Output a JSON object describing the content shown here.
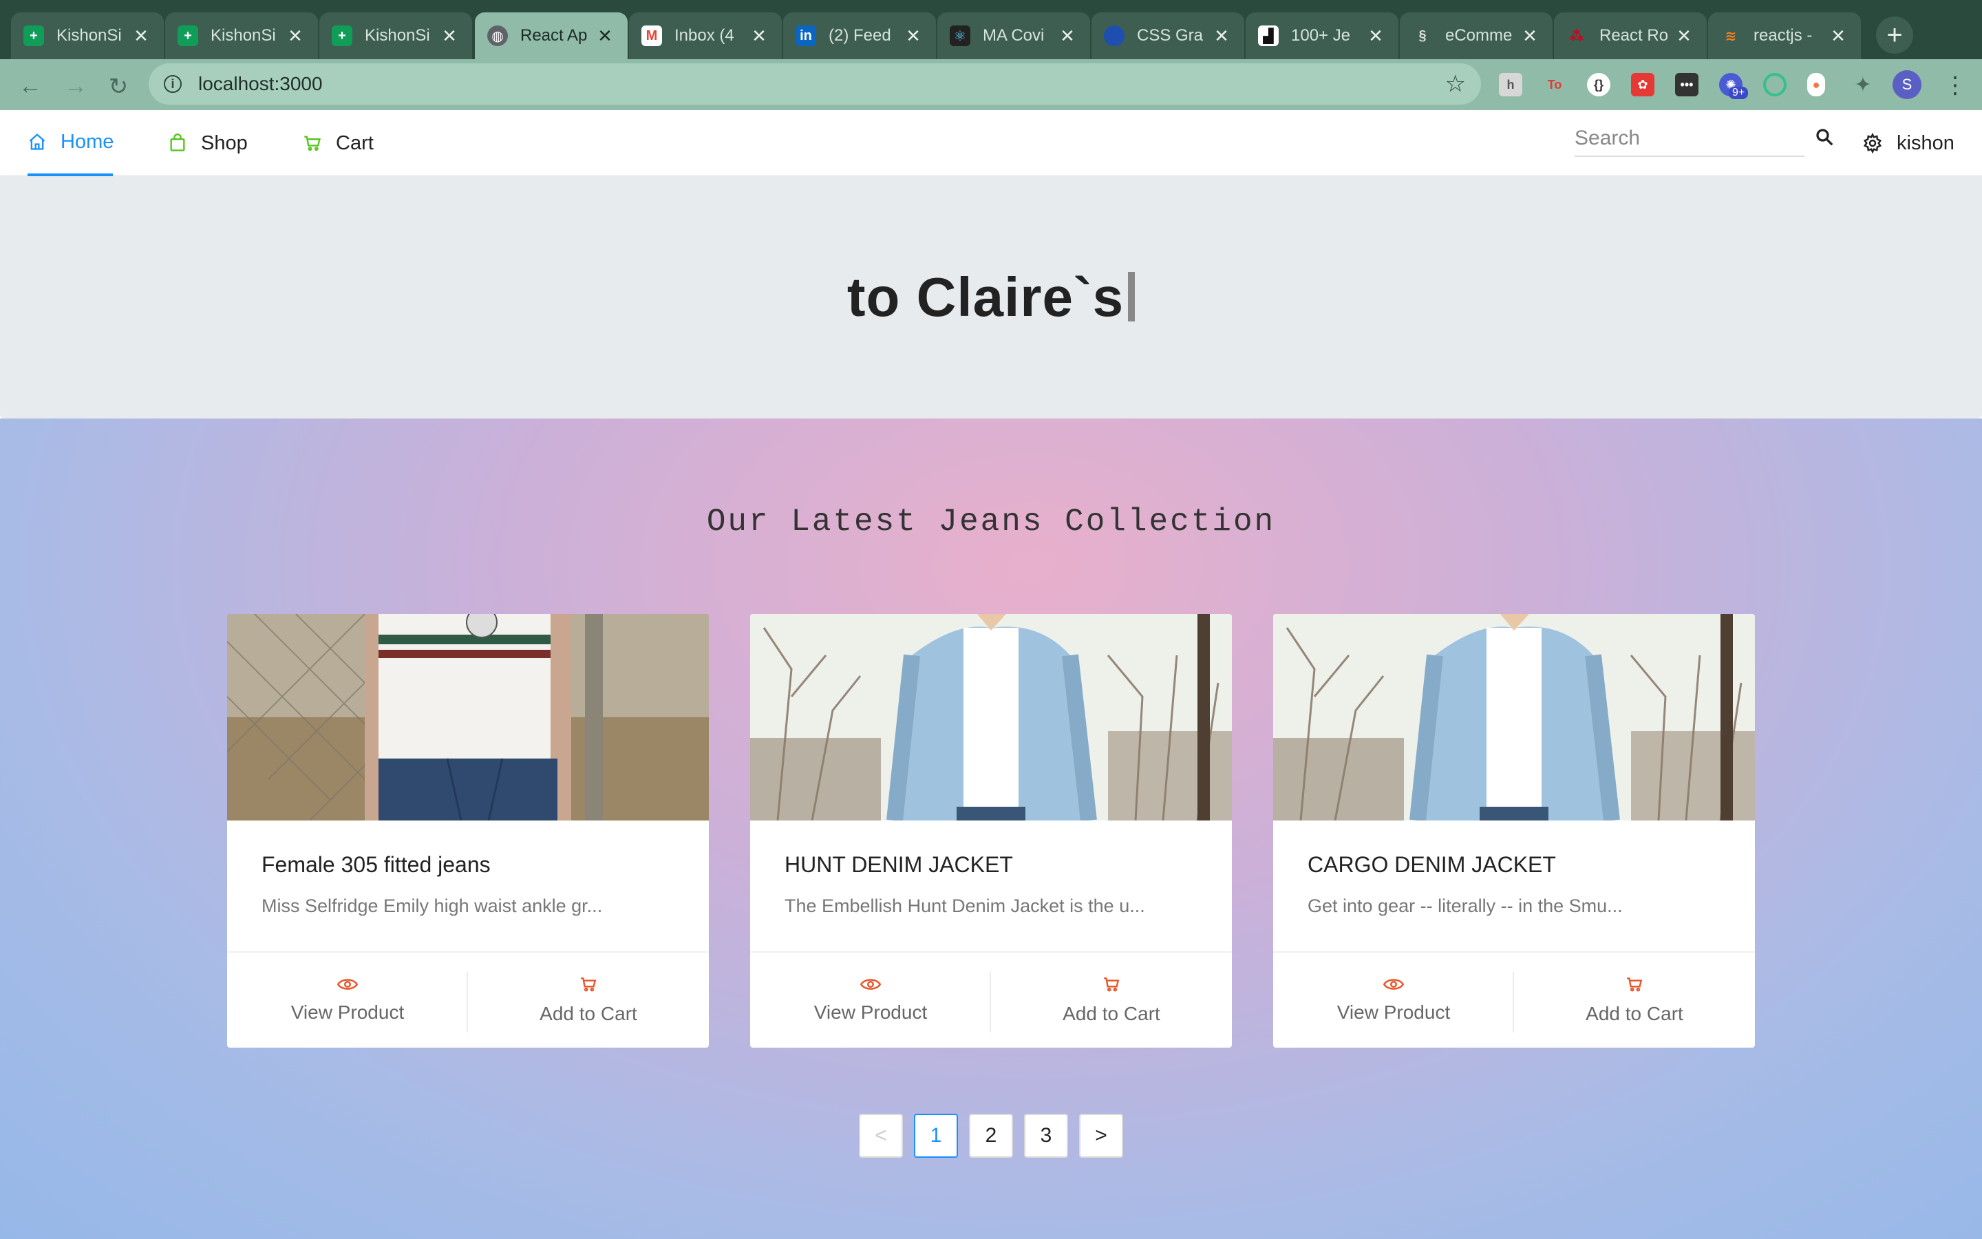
{
  "browser": {
    "tabs": [
      {
        "title": "KishonSi",
        "icon": "google-sheets-icon",
        "color": "#0f9d58"
      },
      {
        "title": "KishonSi",
        "icon": "google-sheets-icon",
        "color": "#0f9d58"
      },
      {
        "title": "KishonSi",
        "icon": "google-sheets-icon",
        "color": "#0f9d58"
      },
      {
        "title": "React Ap",
        "icon": "globe-icon",
        "color": "#5f6368"
      },
      {
        "title": "Inbox (4",
        "icon": "gmail-icon",
        "color": "#ea4335"
      },
      {
        "title": "(2) Feed",
        "icon": "linkedin-icon",
        "color": "#0a66c2"
      },
      {
        "title": "MA Covi",
        "icon": "react-icon",
        "color": "#222222"
      },
      {
        "title": "CSS Gra",
        "icon": "circle-icon",
        "color": "#1e4fb0"
      },
      {
        "title": "100+ Je",
        "icon": "unsplash-icon",
        "color": "#111111"
      },
      {
        "title": "eComme",
        "icon": "squarespace-icon",
        "color": "#555555"
      },
      {
        "title": "React Ro",
        "icon": "react-router-icon",
        "color": "#d0021b"
      },
      {
        "title": "reactjs -",
        "icon": "stackoverflow-icon",
        "color": "#f48024"
      }
    ],
    "url": "localhost:3000",
    "profile_initial": "S",
    "extension_badge": "9+"
  },
  "nav": {
    "home": "Home",
    "shop": "Shop",
    "cart": "Cart",
    "search_placeholder": "Search",
    "user": "kishon"
  },
  "hero": {
    "text": "to Claire`s"
  },
  "collection": {
    "title": "Our Latest Jeans Collection",
    "products": [
      {
        "name": "Female 305 fitted jeans",
        "desc": "Miss Selfridge Emily high waist ankle gr...",
        "view": "View Product",
        "cart": "Add to Cart"
      },
      {
        "name": "HUNT DENIM JACKET",
        "desc": "The Embellish Hunt Denim Jacket is the u...",
        "view": "View Product",
        "cart": "Add to Cart"
      },
      {
        "name": "CARGO DENIM JACKET",
        "desc": "Get into gear -- literally -- in the Smu...",
        "view": "View Product",
        "cart": "Add to Cart"
      }
    ]
  },
  "pagination": {
    "prev": "<",
    "pages": [
      "1",
      "2",
      "3"
    ],
    "next": ">",
    "current": "1"
  }
}
